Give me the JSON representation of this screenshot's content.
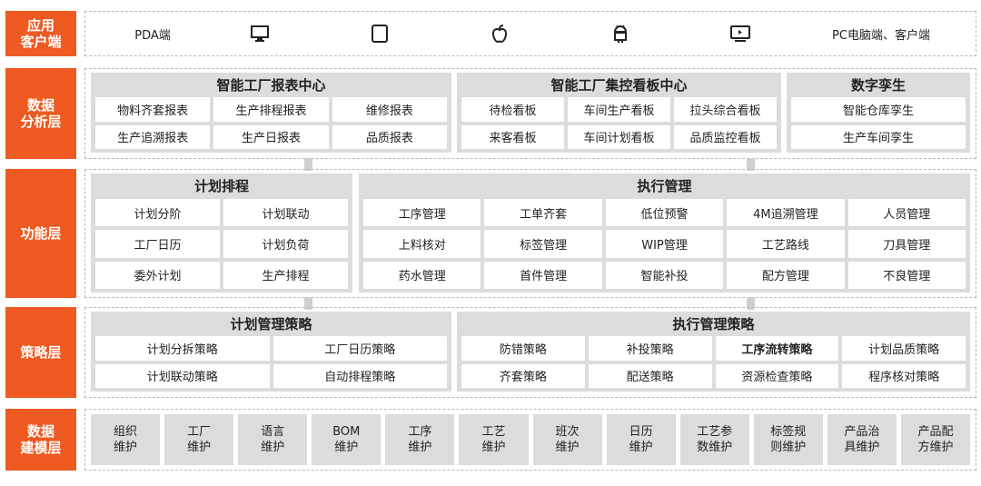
{
  "layers": {
    "client": "应用\n客户端",
    "analysis": "数据\n分析层",
    "function": "功能层",
    "strategy": "策略层",
    "modeling": "数据\n建模层"
  },
  "client": {
    "pda": "PDA端",
    "pc": "PC电脑端、客户端",
    "icons": [
      "monitor-icon",
      "tablet-icon",
      "apple-icon",
      "android-icon",
      "tv-icon"
    ]
  },
  "analysis": {
    "report": {
      "title": "智能工厂报表中心",
      "items": [
        "物料齐套报表",
        "生产排程报表",
        "维修报表",
        "生产追溯报表",
        "生产日报表",
        "品质报表"
      ]
    },
    "board": {
      "title": "智能工厂集控看板中心",
      "items": [
        "待检看板",
        "车间生产看板",
        "拉头综合看板",
        "来客看板",
        "车间计划看板",
        "品质监控看板"
      ]
    },
    "twin": {
      "title": "数字孪生",
      "items": [
        "智能仓库孪生",
        "生产车间孪生"
      ]
    }
  },
  "function": {
    "plan": {
      "title": "计划排程",
      "items": [
        "计划分阶",
        "计划联动",
        "工厂日历",
        "计划负荷",
        "委外计划",
        "生产排程"
      ]
    },
    "exec": {
      "title": "执行管理",
      "items": [
        "工序管理",
        "工单齐套",
        "低位预警",
        "4M追溯管理",
        "人员管理",
        "上料核对",
        "标签管理",
        "WIP管理",
        "工艺路线",
        "刀具管理",
        "药水管理",
        "首件管理",
        "智能补投",
        "配方管理",
        "不良管理"
      ]
    }
  },
  "strategy": {
    "plan": {
      "title": "计划管理策略",
      "items": [
        "计划分拆策略",
        "工厂日历策略",
        "计划联动策略",
        "自动排程策略"
      ]
    },
    "exec": {
      "title": "执行管理策略",
      "items": [
        "防错策略",
        "补投策略",
        "工序流转策略",
        "计划品质策略",
        "齐套策略",
        "配送策略",
        "资源检查策略",
        "程序核对策略"
      ]
    }
  },
  "modeling": {
    "items": [
      "组织\n维护",
      "工厂\n维护",
      "语言\n维护",
      "BOM\n维护",
      "工序\n维护",
      "工艺\n维护",
      "班次\n维护",
      "日历\n维护",
      "工艺参\n数维护",
      "标签规\n则维护",
      "产品治\n具维护",
      "产品配\n方维护"
    ]
  }
}
